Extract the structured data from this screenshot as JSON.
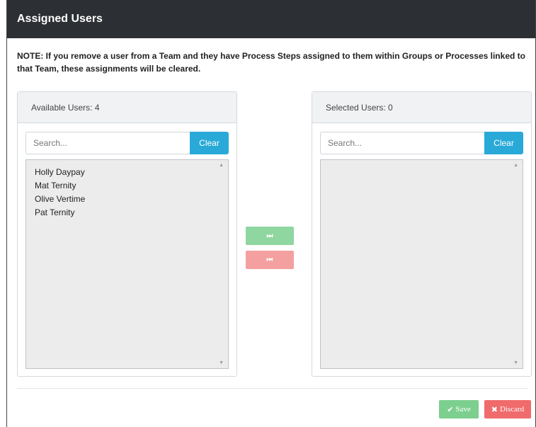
{
  "modal": {
    "title": "Assigned Users",
    "note": "NOTE: If you remove a user from a Team and they have Process Steps assigned to them within Groups or Processes linked to that Team, these assignments will be cleared."
  },
  "available": {
    "heading": "Available Users: 4",
    "search_placeholder": "Search...",
    "clear_label": "Clear",
    "users": [
      "Holly Daypay",
      "Mat Ternity",
      "Olive Vertime",
      "Pat Ternity"
    ]
  },
  "selected": {
    "heading": "Selected Users: 0",
    "search_placeholder": "Search...",
    "clear_label": "Clear",
    "users": []
  },
  "transfer": {
    "move_right_icon": "⏭",
    "move_left_icon": "⏮"
  },
  "footer": {
    "save_label": "Save",
    "save_icon": "✔",
    "discard_label": "Discard",
    "discard_icon": "✖"
  },
  "colors": {
    "header_bg": "#2c2f33",
    "clear_button": "#29a9d8",
    "move_right": "#8fd6a0",
    "move_left": "#f4a0a0",
    "save": "#7dcf8f",
    "discard": "#f06b6b"
  }
}
